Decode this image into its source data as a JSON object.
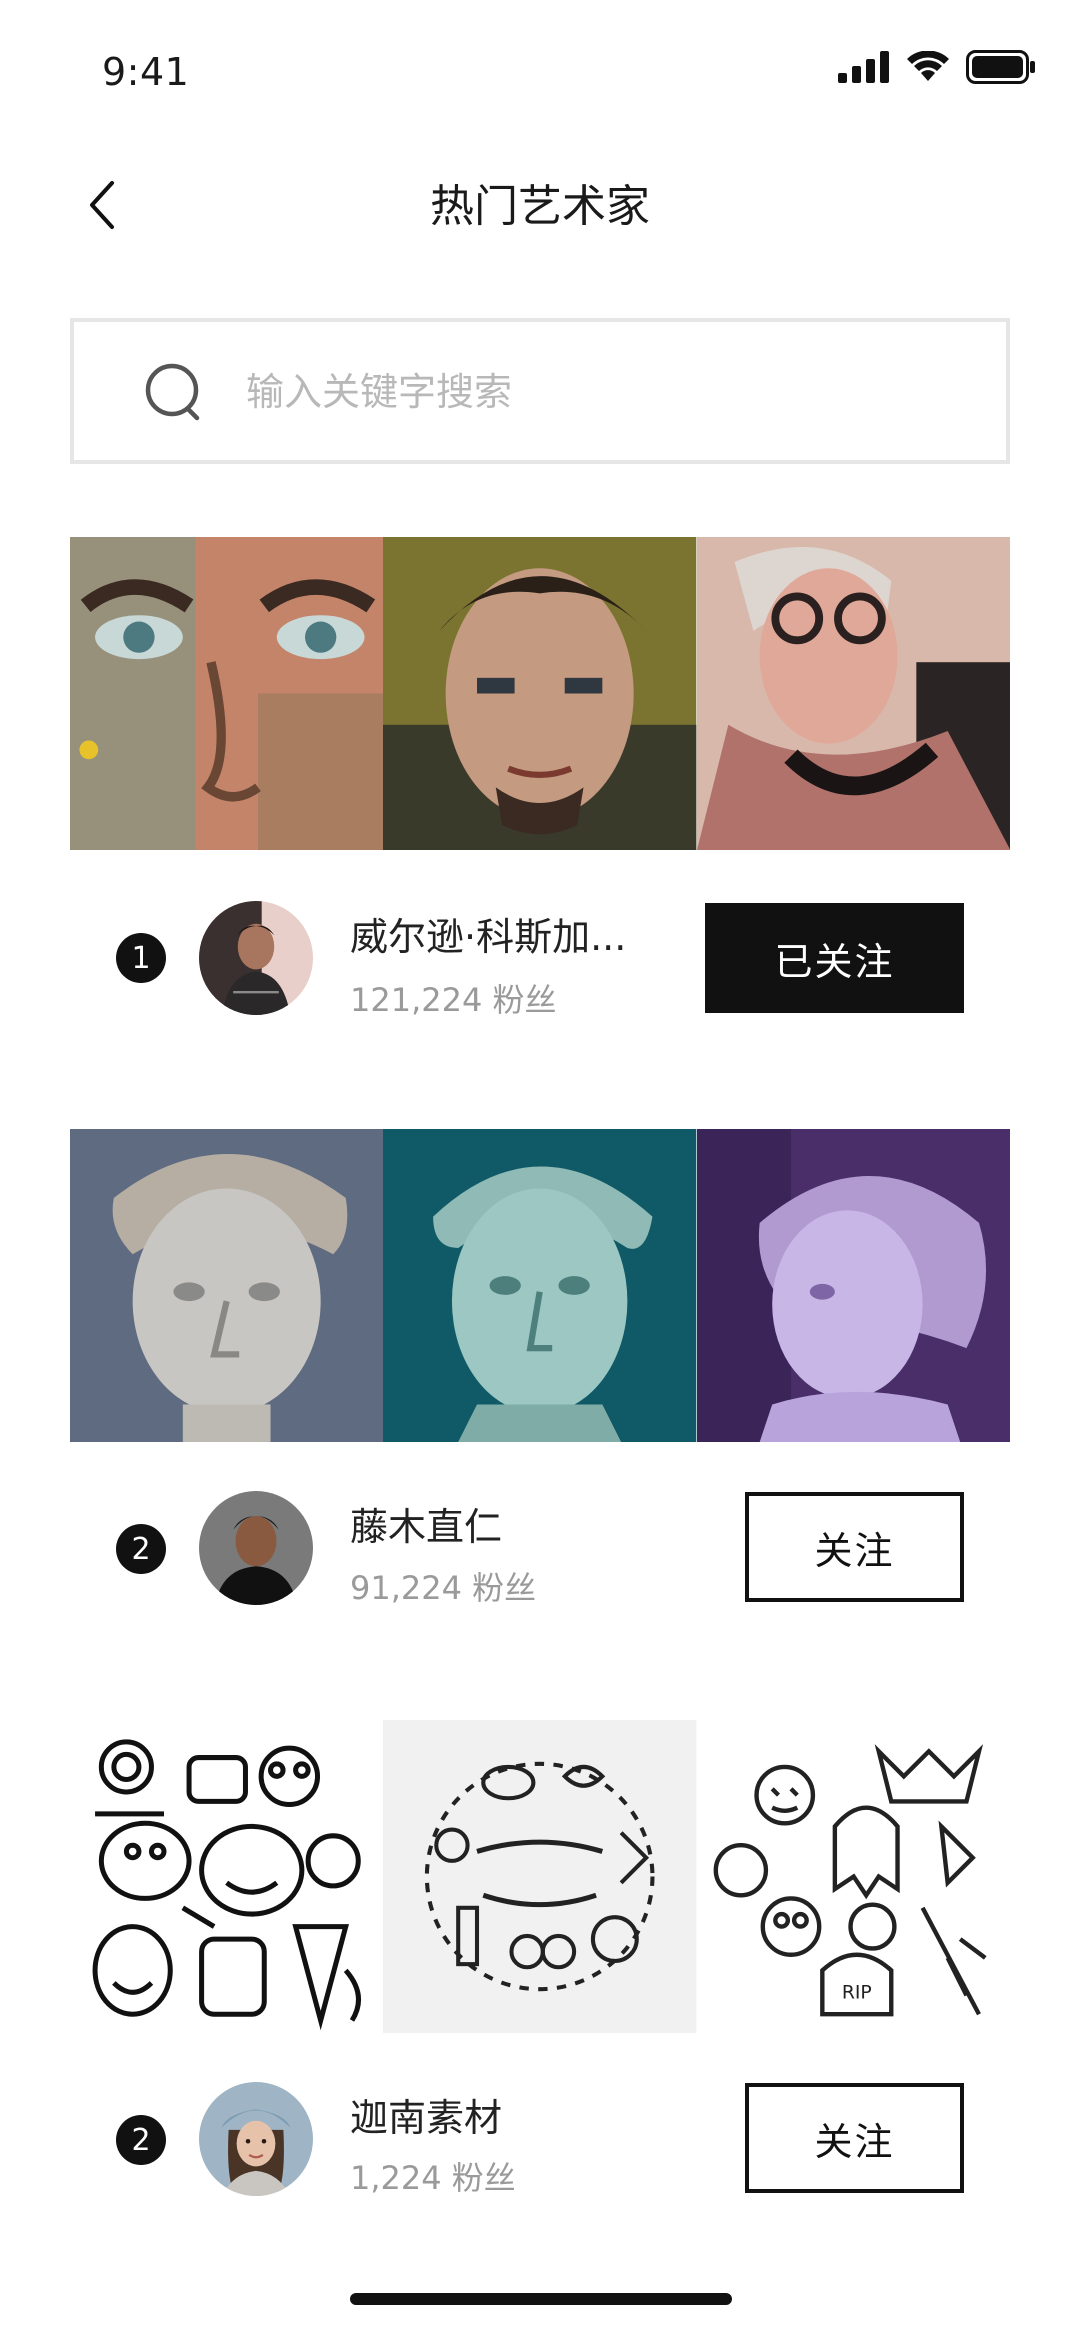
{
  "status_bar": {
    "time": "9:41"
  },
  "header": {
    "title": "热门艺术家"
  },
  "search": {
    "placeholder": "输入关键字搜索"
  },
  "artists": [
    {
      "rank": "1",
      "name": "威尔逊·科斯加...",
      "fans": "121,224 粉丝",
      "button": "已关注",
      "followed": true
    },
    {
      "rank": "2",
      "name": "藤木直仁",
      "fans": "91,224 粉丝",
      "button": "关注",
      "followed": false
    },
    {
      "rank": "2",
      "name": "迦南素材",
      "fans": "1,224 粉丝",
      "button": "关注",
      "followed": false
    }
  ],
  "icons": {
    "back": "chevron-left-icon",
    "search": "search-icon",
    "signal": "signal-icon",
    "wifi": "wifi-icon",
    "battery": "battery-icon"
  },
  "colors": {
    "accent": "#111111",
    "muted": "#9a9a9a",
    "border": "#e6e6e6"
  }
}
